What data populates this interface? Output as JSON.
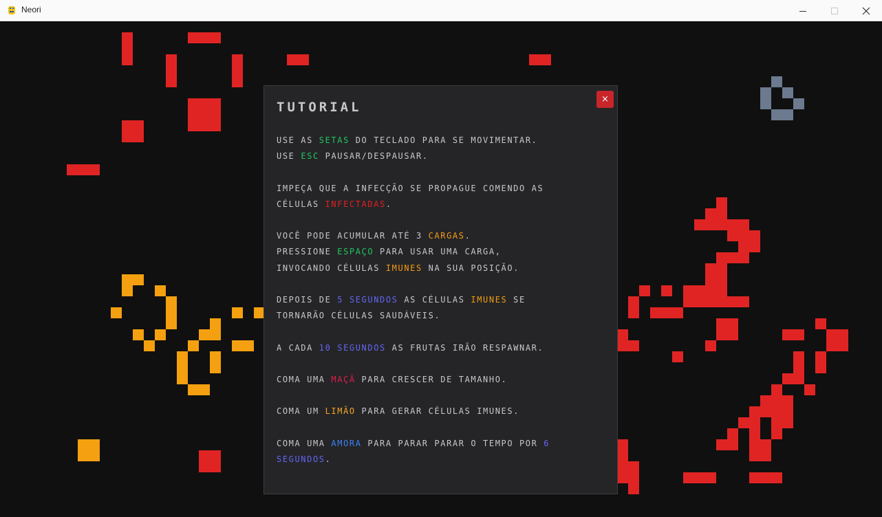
{
  "window": {
    "title": "Neori",
    "controls": [
      "minimize",
      "maximize",
      "close"
    ]
  },
  "colors": {
    "background": "#101010",
    "infected": "#e02424",
    "immune": "#f5a010",
    "healthy": "#6b7a8f",
    "dialog_bg": "#252528"
  },
  "tutorial": {
    "title": "TUTORIAL",
    "close_label": "×",
    "p1": {
      "l1": {
        "a": "USE AS ",
        "b": "SETAS",
        "c": " DO TECLADO PARA SE MOVIMENTAR."
      },
      "l2": {
        "a": "USE ",
        "b": "ESC",
        "c": " PAUSAR/DESPAUSAR."
      }
    },
    "p2": {
      "l1": {
        "a": "IMPEÇA QUE A INFECÇÃO SE PROPAGUE COMENDO AS"
      },
      "l2": {
        "a": "CÉLULAS ",
        "b": "INFECTADAS",
        "c": "."
      }
    },
    "p3": {
      "l1": {
        "a": "VOCÊ PODE ACUMULAR ATÉ 3 ",
        "b": "CARGAS",
        "c": "."
      },
      "l2": {
        "a": "PRESSIONE ",
        "b": "ESPAÇO",
        "c": " PARA USAR UMA CARGA,"
      },
      "l3": {
        "a": "INVOCANDO CÉLULAS ",
        "b": "IMUNES",
        "c": " NA SUA POSIÇÃO."
      }
    },
    "p4": {
      "l1": {
        "a": "DEPOIS DE ",
        "b": "5 SEGUNDOS",
        "c": " AS CÉLULAS ",
        "d": "IMUNES",
        "e": " SE"
      },
      "l2": {
        "a": "TORNARÃO CÉLULAS SAUDÁVEIS."
      }
    },
    "p5": {
      "l1": {
        "a": "A CADA ",
        "b": "10 SEGUNDOS",
        "c": " AS FRUTAS IRÃO RESPAWNAR."
      }
    },
    "p6": {
      "l1": {
        "a": "COMA UMA ",
        "b": "MAÇÃ",
        "c": " PARA CRESCER DE TAMANHO."
      }
    },
    "p7": {
      "l1": {
        "a": "COMA UM ",
        "b": "LIMÃO",
        "c": " PARA GERAR CÉLULAS IMUNES."
      }
    },
    "p8": {
      "l1": {
        "a": "COMA UMA ",
        "b": "AMORA",
        "c": " PARA PARAR PARAR O TEMPO POR ",
        "d": "6"
      },
      "l2": {
        "a": "SEGUNDOS",
        "b": "."
      }
    }
  }
}
